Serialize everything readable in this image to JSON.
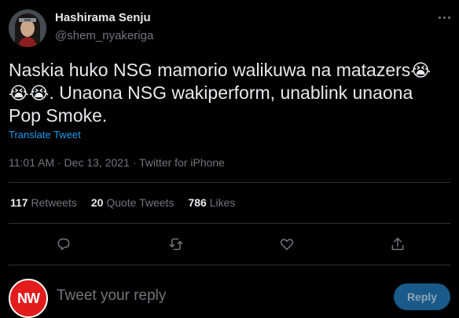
{
  "user": {
    "name": "Hashirama Senju",
    "handle": "@shem_nyakeriga"
  },
  "tweet": {
    "line1": "Naskia huko NSG mamorio walikuwa na matazers",
    "line2": ". Unaona NSG wakiperform, unablink unaona",
    "line3": "Pop Smoke.",
    "emoji": "😭",
    "translate": "Translate Tweet",
    "meta": "11:01 AM · Dec 13, 2021 · Twitter for iPhone"
  },
  "stats": {
    "retweets_count": "117",
    "retweets_label": "Retweets",
    "quotes_count": "20",
    "quotes_label": "Quote Tweets",
    "likes_count": "786",
    "likes_label": "Likes"
  },
  "reply": {
    "avatar_text": "NW",
    "placeholder": "Tweet your reply",
    "button": "Reply"
  },
  "icons": [
    "more-icon",
    "reply-icon",
    "retweet-icon",
    "like-icon",
    "share-icon"
  ]
}
